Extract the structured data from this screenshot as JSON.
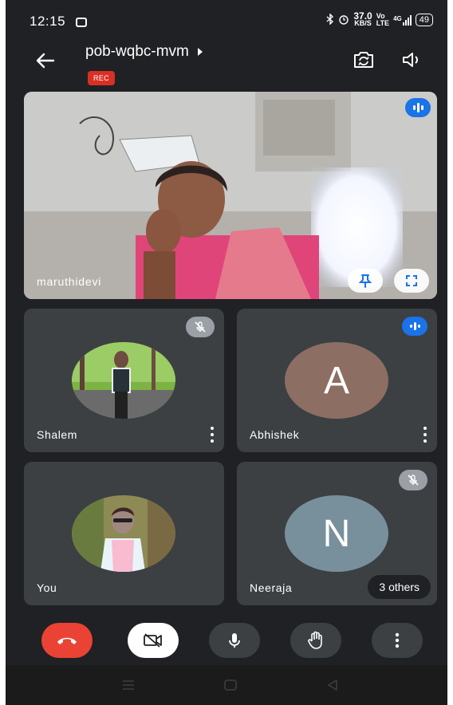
{
  "status_bar": {
    "time": "12:15",
    "net_speed_value": "37.0",
    "net_speed_unit": "KB/S",
    "network_label": "4G",
    "battery": "49"
  },
  "header": {
    "meeting_code": "pob-wqbc-mvm",
    "rec_label": "REC",
    "icons": [
      "back-arrow-icon",
      "switch-camera-icon",
      "speaker-icon"
    ]
  },
  "main_tile": {
    "participant_name": "maruthidevi",
    "speaking": true
  },
  "tiles": [
    {
      "name": "Shalem",
      "muted": true,
      "avatar": "photo"
    },
    {
      "name": "Abhishek",
      "speaking": true,
      "avatar_letter": "A",
      "avatar_color": "#8d6e63"
    },
    {
      "name": "You",
      "avatar": "photo"
    },
    {
      "name": "Neeraja",
      "muted": true,
      "avatar_letter": "N",
      "avatar_color": "#78909c",
      "others_label": "3 others"
    }
  ],
  "controls": [
    "end-call-icon",
    "camera-off-icon",
    "microphone-icon",
    "raise-hand-icon",
    "more-options-icon"
  ],
  "colors": {
    "background": "#202124",
    "tile": "#3c4043",
    "end_call": "#ea4335",
    "speaking_blue": "#1a73e8",
    "rec_red": "#d93025"
  }
}
